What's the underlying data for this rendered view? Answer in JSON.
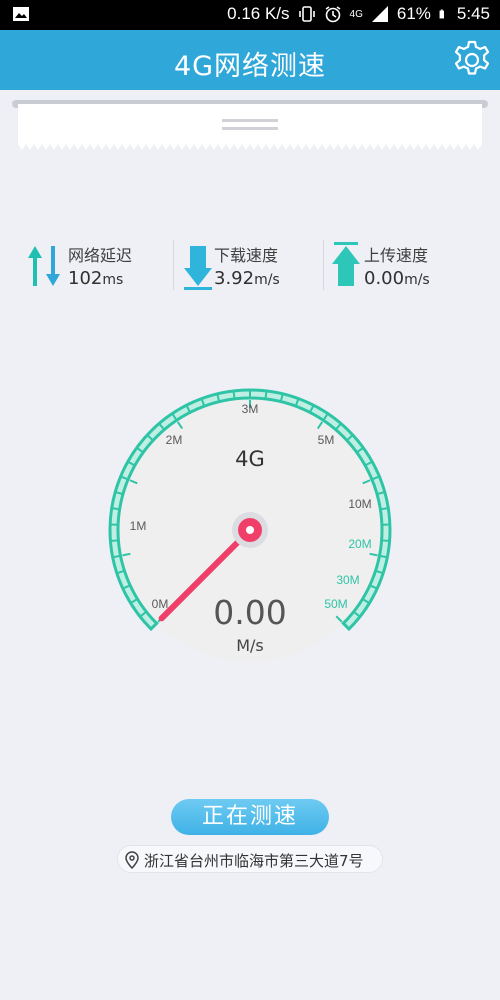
{
  "status_bar": {
    "speed": "0.16 K/s",
    "network": "4G",
    "battery": "61%",
    "time": "5:45",
    "icons": [
      "image-icon",
      "vibrate-icon",
      "alarm-icon",
      "signal-icon",
      "battery-icon"
    ]
  },
  "app_bar": {
    "title": "4G网络测速",
    "settings_icon": "gear-icon"
  },
  "stats": [
    {
      "label": "网络延迟",
      "value": "102",
      "unit": "ms",
      "icon": "up-down-arrows-icon"
    },
    {
      "label": "下载速度",
      "value": "3.92",
      "unit": "m/s",
      "icon": "download-arrow-icon"
    },
    {
      "label": "上传速度",
      "value": "0.00",
      "unit": "m/s",
      "icon": "upload-arrow-icon"
    }
  ],
  "gauge": {
    "network_label": "4G",
    "speed_value": "0.00",
    "speed_unit": "M/s",
    "tick_labels": [
      "0M",
      "1M",
      "2M",
      "3M",
      "5M",
      "10M",
      "20M",
      "30M",
      "50M"
    ],
    "needle_value": 0,
    "colors": {
      "arc": "#2fc4a6",
      "needle": "#f0406a",
      "label_gray": "#5a5a5a",
      "label_green": "#2fc4a6"
    }
  },
  "action": {
    "start_label": "正在测速"
  },
  "location": {
    "text": "浙江省台州市临海市第三大道7号",
    "icon": "location-pin-icon"
  }
}
